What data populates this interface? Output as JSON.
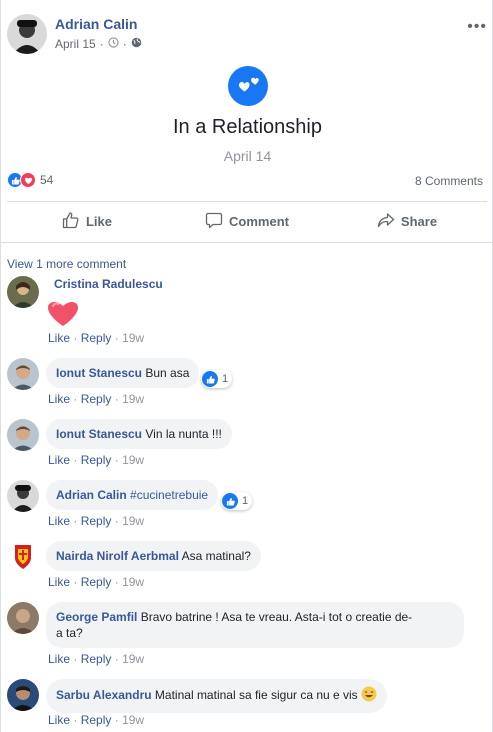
{
  "post": {
    "author": "Adrian Calin",
    "date": "April 15",
    "more_label": "•••",
    "event_title": "In a Relationship",
    "event_date": "April 14",
    "reaction_count": "54",
    "comments_count": "8 Comments"
  },
  "actions": {
    "like": "Like",
    "comment": "Comment",
    "share": "Share"
  },
  "view_more": "View 1 more comment",
  "comments": [
    {
      "name": "Cristina Radulescu",
      "text": "",
      "like": "Like",
      "reply": "Reply",
      "time": "19w",
      "likes": ""
    },
    {
      "name": "Ionut Stanescu",
      "text": "Bun asa",
      "like": "Like",
      "reply": "Reply",
      "time": "19w",
      "likes": "1"
    },
    {
      "name": "Ionut Stanescu",
      "text": "Vin la nunta !!!",
      "like": "Like",
      "reply": "Reply",
      "time": "19w",
      "likes": ""
    },
    {
      "name": "Adrian Calin",
      "text": "#cucinetrebuie",
      "like": "Like",
      "reply": "Reply",
      "time": "19w",
      "likes": "1"
    },
    {
      "name": "Nairda Nirolf Aerbmal",
      "text": "Asa matinal?",
      "like": "Like",
      "reply": "Reply",
      "time": "19w",
      "likes": ""
    },
    {
      "name": "George Pamfil",
      "text": "Bravo batrine ! Asa te vreau. Asta-i tot o creatie de-",
      "text2": "a ta?",
      "like": "Like",
      "reply": "Reply",
      "time": "19w",
      "likes": ""
    },
    {
      "name": "Sarbu Alexandru",
      "text": "Matinal matinal sa fie sigur ca nu e vis",
      "like": "Like",
      "reply": "Reply",
      "time": "19w",
      "likes": ""
    }
  ],
  "colors": {
    "link": "#385898",
    "accent": "#1877f2",
    "heart": "#f33e58"
  }
}
